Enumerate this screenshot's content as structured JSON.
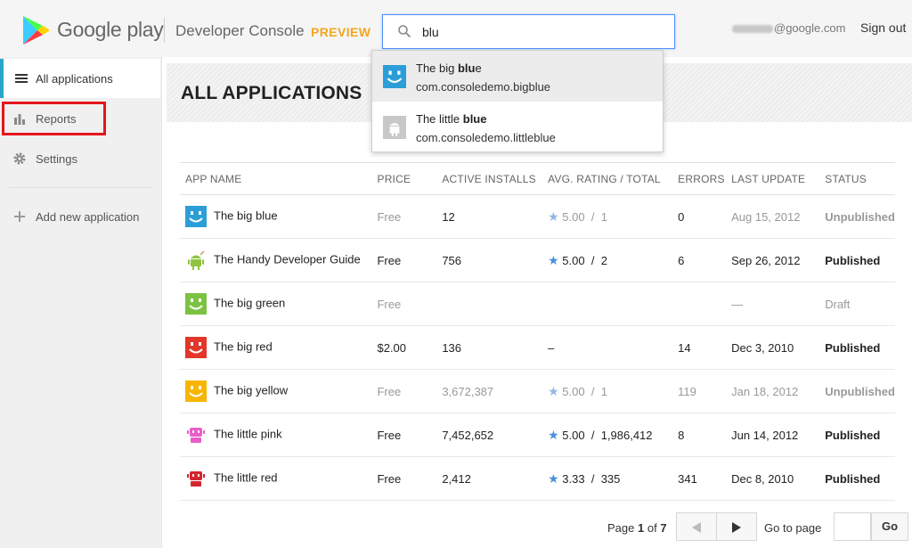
{
  "header": {
    "brand": "Google play",
    "console": "Developer Console",
    "preview": "PREVIEW",
    "search_value": "blu",
    "account_domain": "@google.com",
    "sign_out": "Sign out"
  },
  "sidebar": {
    "items": [
      {
        "label": "All applications",
        "icon": "list-icon"
      },
      {
        "label": "Reports",
        "icon": "bar-chart-icon"
      },
      {
        "label": "Settings",
        "icon": "gear-icon"
      },
      {
        "label": "Add new application",
        "icon": "plus-icon"
      }
    ]
  },
  "main": {
    "title": "ALL APPLICATIONS",
    "columns": [
      "APP NAME",
      "PRICE",
      "ACTIVE INSTALLS",
      "AVG. RATING / TOTAL",
      "ERRORS",
      "LAST UPDATE",
      "STATUS"
    ],
    "rows": [
      {
        "name": "The big blue",
        "icon": "blue-smiley-icon",
        "price": "Free",
        "installs": "12",
        "rating": "5.00",
        "sep": "/",
        "total": "1",
        "errors": "0",
        "updated": "Aug 15, 2012",
        "status": "Unpublished"
      },
      {
        "name": "The Handy Developer Guide",
        "icon": "android-icon",
        "price": "Free",
        "installs": "756",
        "rating": "5.00",
        "sep": "/",
        "total": "2",
        "errors": "6",
        "updated": "Sep 26, 2012",
        "status": "Published"
      },
      {
        "name": "The big green",
        "icon": "green-smiley-icon",
        "price": "Free",
        "installs": "",
        "rating": "",
        "sep": "",
        "total": "",
        "errors": "",
        "updated": "—",
        "status": "Draft"
      },
      {
        "name": "The big red",
        "icon": "red-smiley-icon",
        "price": "$2.00",
        "installs": "136",
        "rating_dash": "–",
        "errors": "14",
        "updated": "Dec 3, 2010",
        "status": "Published"
      },
      {
        "name": "The big yellow",
        "icon": "yellow-smiley-icon",
        "price": "Free",
        "installs": "3,672,387",
        "rating": "5.00",
        "sep": "/",
        "total": "1",
        "errors": "119",
        "updated": "Jan 18, 2012",
        "status": "Unpublished"
      },
      {
        "name": "The little pink",
        "icon": "pink-robot-icon",
        "price": "Free",
        "installs": "7,452,652",
        "rating": "5.00",
        "sep": "/",
        "total": "1,986,412",
        "errors": "8",
        "updated": "Jun 14, 2012",
        "status": "Published"
      },
      {
        "name": "The little red",
        "icon": "red-robot-icon",
        "price": "Free",
        "installs": "2,412",
        "rating": "3.33",
        "sep": "/",
        "total": "335",
        "errors": "341",
        "updated": "Dec 8, 2010",
        "status": "Published"
      }
    ],
    "pager": {
      "prefix": "Page",
      "page": "1",
      "of": "of",
      "total": "7",
      "goto_label": "Go to page",
      "go_button": "Go"
    }
  },
  "dropdown": {
    "items": [
      {
        "name_prefix": "The big ",
        "name_match": "blu",
        "name_suffix": "e",
        "package": "com.consoledemo.bigblue",
        "icon": "blue-smiley-icon"
      },
      {
        "name_prefix": "The little ",
        "name_match": "blue",
        "name_suffix": "",
        "package": "com.consoledemo.littleblue",
        "icon": "android-placeholder-icon"
      }
    ]
  },
  "colors": {
    "accent": "#2aa5c8",
    "preview": "#f4a51c",
    "highlight": "#e3161b",
    "star": "#4a90d9",
    "search_border": "#4d90fe"
  }
}
